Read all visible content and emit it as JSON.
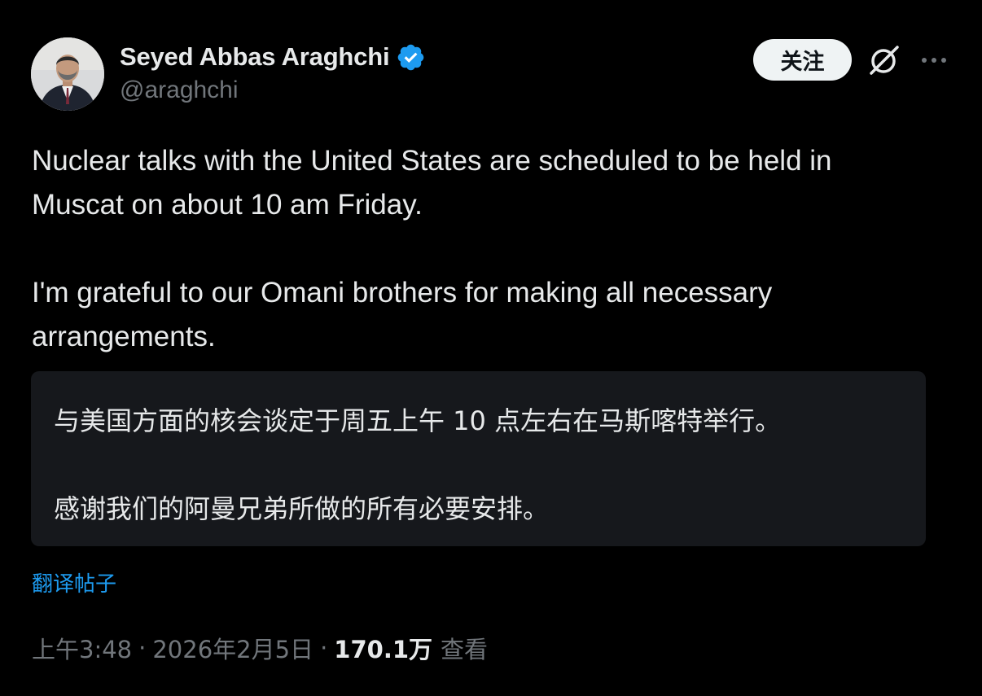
{
  "author": {
    "display_name": "Seyed Abbas Araghchi",
    "handle": "@araghchi",
    "verified": true,
    "verified_color": "#1d9bf0"
  },
  "actions": {
    "follow_label": "关注",
    "grok_icon": "grok-icon",
    "more_icon": "more-horizontal-icon"
  },
  "post": {
    "paragraph1_line1": "Nuclear talks with the United States are scheduled to be held in",
    "paragraph1_line2": "Muscat on about 10 am Friday.",
    "paragraph2_line1": "I'm grateful to our Omani brothers for making all necessary",
    "paragraph2_line2": "arrangements."
  },
  "translation": {
    "line1": "与美国方面的核会谈定于周五上午 10 点左右在马斯喀特举行。",
    "line2": "感谢我们的阿曼兄弟所做的所有必要安排。",
    "link_label": "翻译帖子"
  },
  "meta": {
    "time": "上午3:48",
    "date": "2026年2月5日",
    "views_count": "170.1万",
    "views_label": "查看",
    "separator": "·"
  }
}
